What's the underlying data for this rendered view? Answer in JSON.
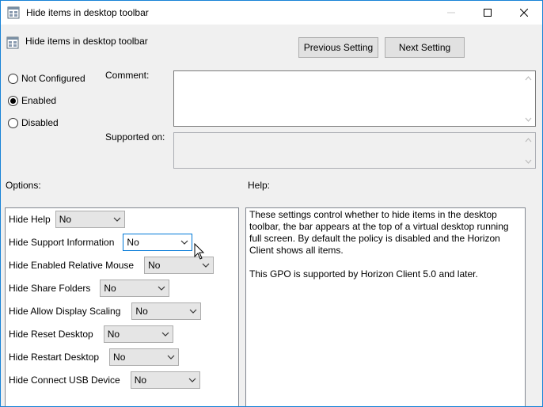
{
  "window": {
    "title": "Hide items in desktop toolbar"
  },
  "header": {
    "policy_name": "Hide items in desktop toolbar",
    "prev_label": "Previous Setting",
    "next_label": "Next Setting"
  },
  "state": {
    "options": [
      {
        "label": "Not Configured",
        "selected": false
      },
      {
        "label": "Enabled",
        "selected": true
      },
      {
        "label": "Disabled",
        "selected": false
      }
    ]
  },
  "fields": {
    "comment_label": "Comment:",
    "comment_value": "",
    "supported_label": "Supported on:",
    "supported_value": ""
  },
  "sections": {
    "options_label": "Options:",
    "help_label": "Help:"
  },
  "options": [
    {
      "label": "Hide Help",
      "value": "No"
    },
    {
      "label": "Hide Support Information",
      "value": "No"
    },
    {
      "label": "Hide Enabled Relative Mouse",
      "value": "No"
    },
    {
      "label": "Hide Share Folders",
      "value": "No"
    },
    {
      "label": "Hide Allow Display Scaling",
      "value": "No"
    },
    {
      "label": "Hide Reset Desktop",
      "value": "No"
    },
    {
      "label": "Hide Restart Desktop",
      "value": "No"
    },
    {
      "label": "Hide Connect USB Device",
      "value": "No"
    }
  ],
  "help": {
    "text": "These settings control whether to hide items in the desktop toolbar, the bar appears at the top of a virtual desktop running full screen. By default the policy is disabled and the Horizon Client shows all items.\n\nThis GPO is supported by Horizon Client 5.0 and later."
  },
  "icons": {
    "title": "policy-icon",
    "header": "policy-icon",
    "minimize": "minimize-icon",
    "maximize": "maximize-icon",
    "close": "close-icon",
    "dropdown": "chevron-down-icon",
    "cursor": "mouse-pointer-icon"
  },
  "colors": {
    "window_border": "#1883d7",
    "focus_border": "#0078d7",
    "dialog_bg": "#f0f0f0"
  }
}
